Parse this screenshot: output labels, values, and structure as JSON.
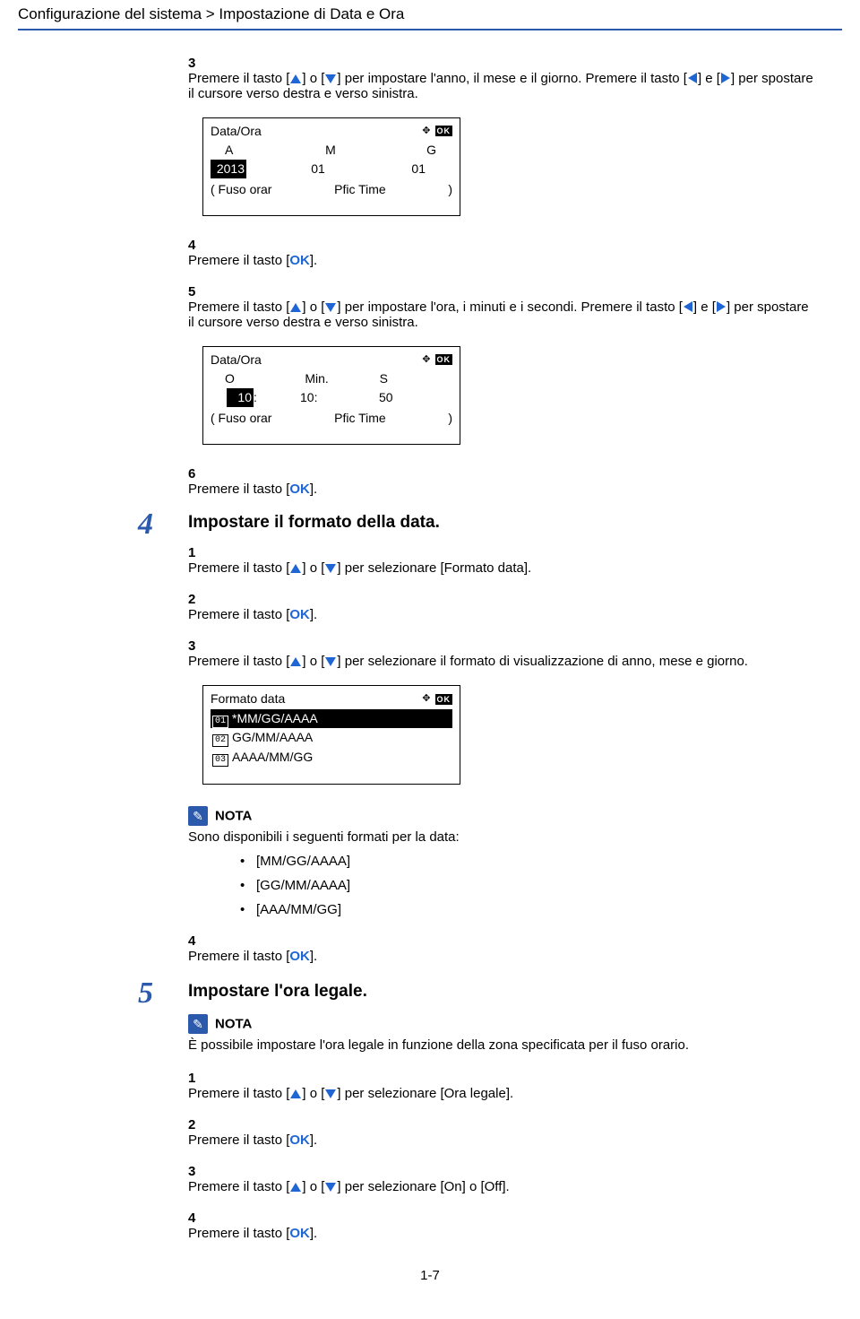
{
  "breadcrumb": "Configurazione del sistema > Impostazione di Data e Ora",
  "step3": {
    "num": "3",
    "t1": "Premere il tasto [",
    "t2": "] o [",
    "t3": "] per impostare l'anno, il mese e il giorno. Premere il tasto [",
    "t4": "] e [",
    "t5": "] per spostare il cursore verso destra e verso sinistra."
  },
  "lcd1": {
    "title": "Data/Ora",
    "h1": "A",
    "h2": "M",
    "h3": "G",
    "v1": "2013",
    "v2": "01",
    "v3": "01",
    "fk1": "( Fuso orar",
    "fk2": "Pfic Time",
    "fk3": ")"
  },
  "step4": {
    "num": "4",
    "pre": "Premere il tasto [",
    "ok": "OK",
    "post": "]."
  },
  "step5": {
    "num": "5",
    "t1": "Premere il tasto [",
    "t2": "] o [",
    "t3": "] per impostare l'ora, i minuti e i secondi. Premere il tasto [",
    "t4": "] e [",
    "t5": "] per spostare il cursore verso destra e verso sinistra."
  },
  "lcd2": {
    "title": "Data/Ora",
    "h1": "O",
    "h2": "Min.",
    "h3": "S",
    "v1": "10",
    "sep": ":",
    "v2": "10:",
    "v3": "50",
    "fk1": "( Fuso orar",
    "fk2": "Pfic Time",
    "fk3": ")"
  },
  "step6": {
    "num": "6",
    "pre": "Premere il tasto [",
    "ok": "OK",
    "post": "]."
  },
  "section4": {
    "num": "4",
    "title": "Impostare il formato della data.",
    "s1": {
      "num": "1",
      "t1": "Premere il tasto [",
      "t2": "] o [",
      "t3": "] per selezionare [Formato data]."
    },
    "s2": {
      "num": "2",
      "pre": "Premere il tasto [",
      "ok": "OK",
      "post": "]."
    },
    "s3": {
      "num": "3",
      "t1": "Premere il tasto [",
      "t2": "] o [",
      "t3": "] per selezionare il formato di visualizzazione di anno, mese e giorno."
    }
  },
  "lcd3": {
    "title": "Formato data",
    "o1n": "01",
    "o1": "*MM/GG/AAAA",
    "o2n": "02",
    "o2": "GG/MM/AAAA",
    "o3n": "03",
    "o3": "AAAA/MM/GG"
  },
  "note1": {
    "label": "NOTA",
    "body": "Sono disponibili i seguenti formati per la data:",
    "b1": "[MM/GG/AAAA]",
    "b2": "[GG/MM/AAAA]",
    "b3": "[AAA/MM/GG]"
  },
  "s4_4": {
    "num": "4",
    "pre": "Premere il tasto [",
    "ok": "OK",
    "post": "]."
  },
  "section5": {
    "num": "5",
    "title": "Impostare l'ora legale.",
    "note": {
      "label": "NOTA",
      "body": "È possibile impostare l'ora legale in funzione della zona specificata per il fuso orario."
    },
    "s1": {
      "num": "1",
      "t1": "Premere il tasto [",
      "t2": "] o [",
      "t3": "] per selezionare [Ora legale]."
    },
    "s2": {
      "num": "2",
      "pre": "Premere il tasto [",
      "ok": "OK",
      "post": "]."
    },
    "s3": {
      "num": "3",
      "t1": "Premere il tasto [",
      "t2": "] o [",
      "t3": "] per selezionare [On] o [Off]."
    },
    "s4": {
      "num": "4",
      "pre": "Premere il tasto [",
      "ok": "OK",
      "post": "]."
    }
  },
  "pagenum": "1-7"
}
